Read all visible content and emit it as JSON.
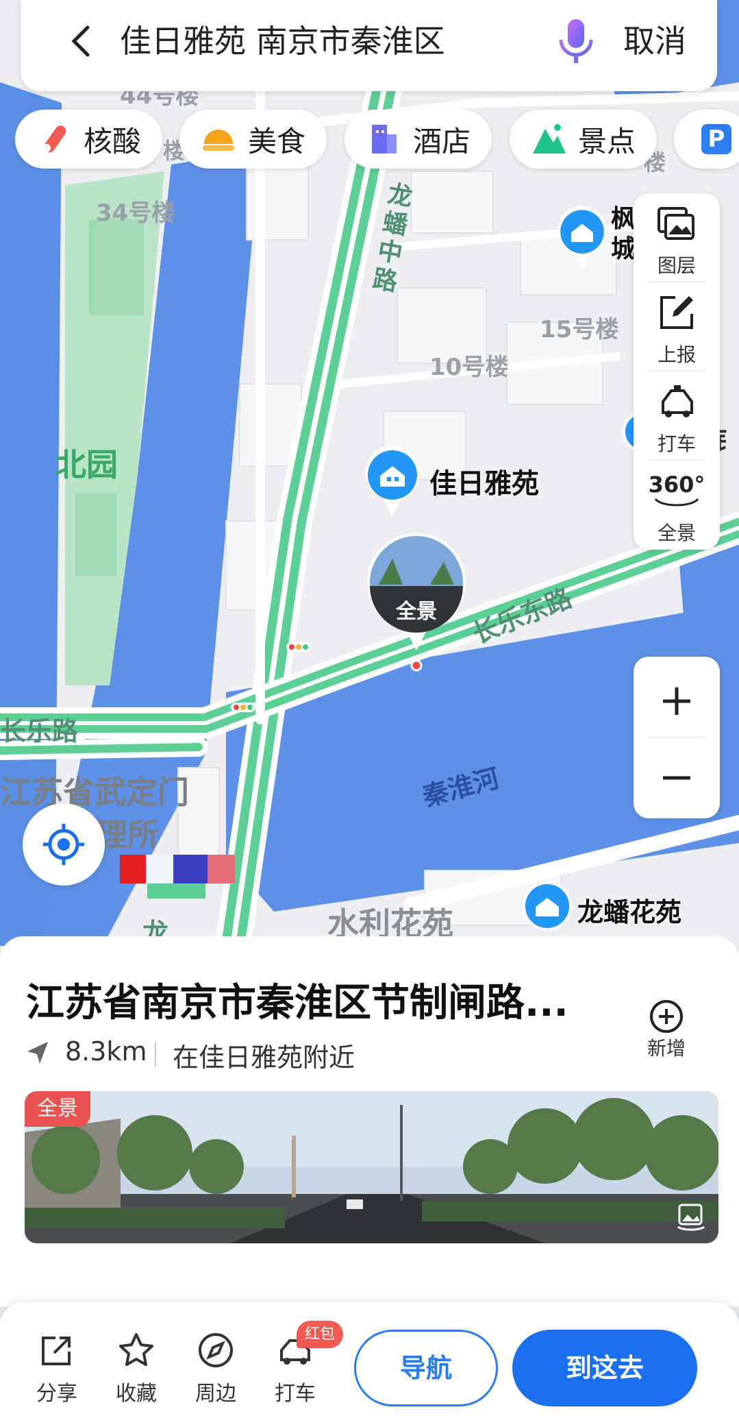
{
  "search": {
    "query": "佳日雅苑 南京市秦淮区",
    "cancel_label": "取消"
  },
  "chips": [
    {
      "label": "核酸",
      "icon": "test-tube-icon"
    },
    {
      "label": "美食",
      "icon": "food-icon"
    },
    {
      "label": "酒店",
      "icon": "hotel-icon"
    },
    {
      "label": "景点",
      "icon": "mountain-icon"
    },
    {
      "label": "P",
      "icon": "parking-icon"
    }
  ],
  "tools": [
    {
      "label": "图层",
      "icon": "layers-icon"
    },
    {
      "label": "上报",
      "icon": "report-icon"
    },
    {
      "label": "打车",
      "icon": "taxi-icon"
    },
    {
      "label": "全景",
      "icon": "panorama-360-icon",
      "glyph": "360°"
    }
  ],
  "map": {
    "labels": {
      "b44": "44号楼",
      "b34": "34号楼",
      "b15": "15号楼",
      "b10": "10号楼",
      "beiyuan": "北园",
      "longpan_road": "龙蟠中路",
      "changle_road": "长乐东路",
      "changle_left": "长乐路",
      "qinhuai_river": "秦淮河",
      "jiangsu_office_1": "江苏省武定门",
      "jiangsu_office_2": "理所",
      "shuili": "水利花苑",
      "longpan_garden": "龙蟠花苑",
      "jiari": "佳日雅苑",
      "fengcheng": "枫城",
      "right_cut": "钅",
      "bottom_cut": "龙",
      "top_right_cut": "楼",
      "left_cut": "楼",
      "pano_bubble": "全景"
    }
  },
  "place": {
    "title": "江苏省南京市秦淮区节制闸路...",
    "add_label": "新增",
    "distance": "8.3km",
    "near": "在佳日雅苑附近",
    "photo_badge": "全景"
  },
  "bottom_bar": {
    "share": "分享",
    "favorite": "收藏",
    "nearby": "周边",
    "taxi": "打车",
    "red_packet": "红包",
    "navigate": "导航",
    "go_here": "到这去"
  },
  "colors": {
    "accent": "#1a6ff0",
    "river": "#4f86e8",
    "road": "#5ccf95",
    "badge": "#e8524f"
  }
}
